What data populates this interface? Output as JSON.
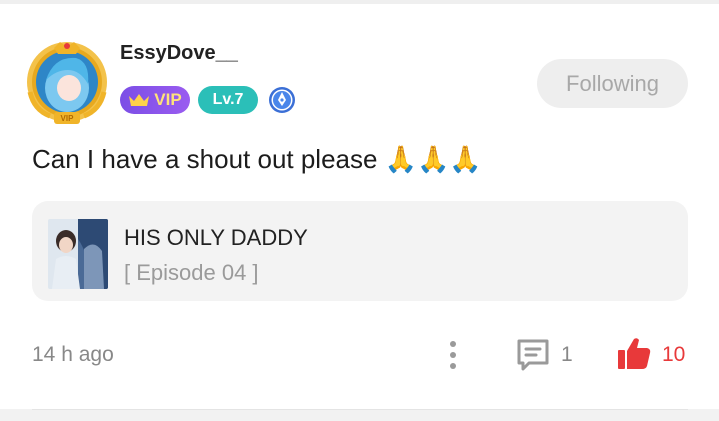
{
  "post": {
    "username": "EssyDove__",
    "vip_label": "VIP",
    "level_label": "Lv.7",
    "follow_label": "Following",
    "text": "Can I have a shout out please 🙏🙏🙏",
    "book": {
      "title": "HIS ONLY DADDY",
      "episode": "[ Episode 04 ]"
    },
    "time_ago": "14 h ago",
    "comment_count": "1",
    "like_count": "10"
  },
  "icons": {
    "avatar": "avatar-with-vip-frame",
    "vip": "crown-icon",
    "pen": "pen-badge-icon",
    "more": "more-vertical-icon",
    "comment": "comment-icon",
    "like": "thumbs-up-icon"
  },
  "colors": {
    "vip_purple": "#8453eb",
    "level_teal": "#2bbfb8",
    "like_red": "#e8393a",
    "gold": "#f0b429"
  }
}
